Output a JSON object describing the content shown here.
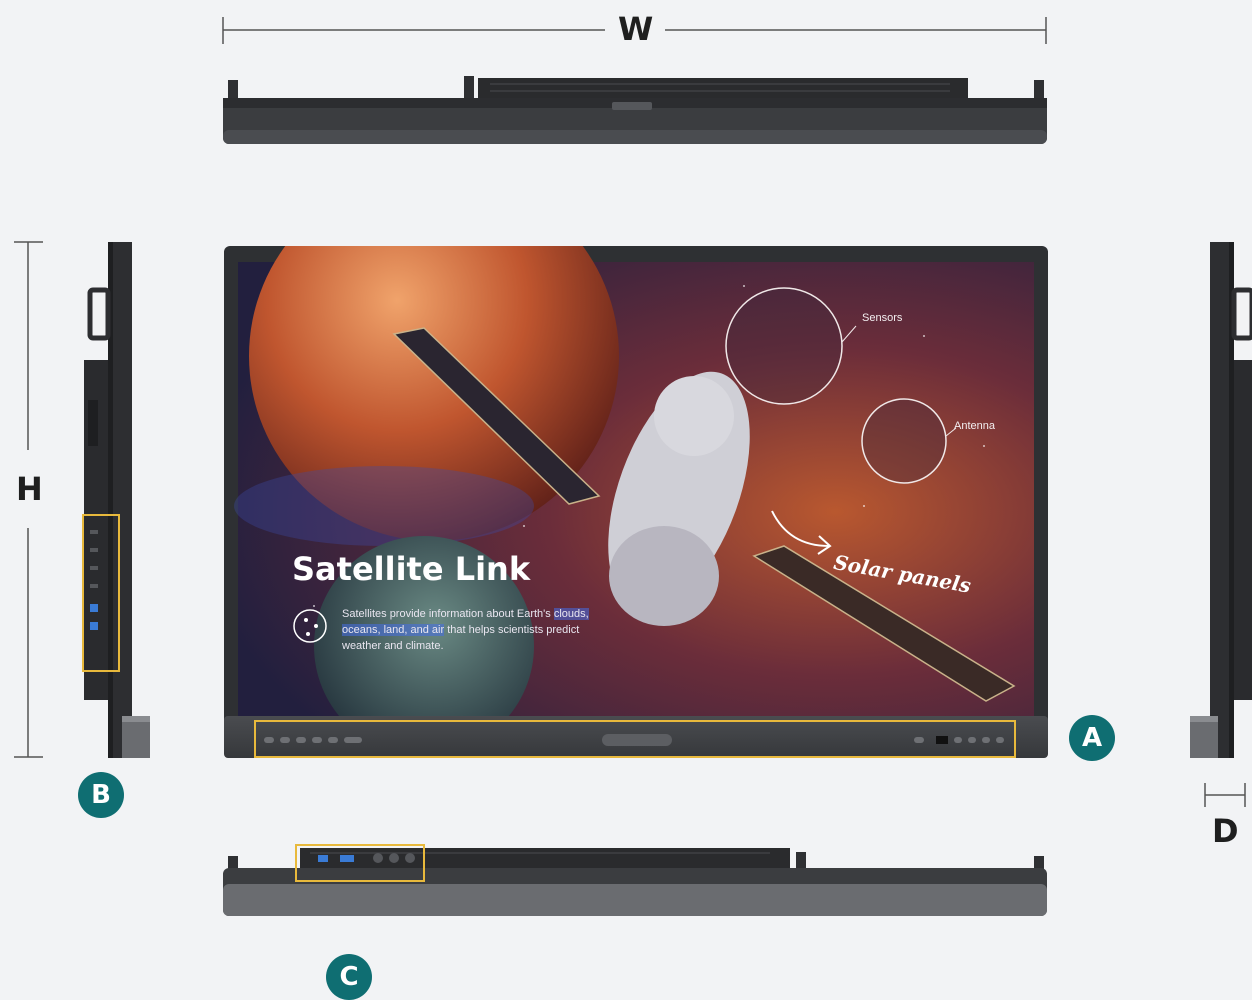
{
  "dimensions": {
    "width_label": "W",
    "height_label": "H",
    "depth_label": "D"
  },
  "badges": {
    "a": "A",
    "b": "B",
    "c": "C"
  },
  "screen": {
    "title": "Satellite Link",
    "body_before": "Satellites provide information about Earth's ",
    "body_highlight": "clouds, oceans, land, and air",
    "body_after": " that helps scientists predict weather and climate.",
    "callout_sensors": "Sensors",
    "callout_antenna": "Antenna",
    "callout_solar": "Solar panels"
  },
  "colors": {
    "background": "#f2f3f5",
    "badge": "#0f6e72",
    "highlight_frame": "#e8b93c",
    "device_body": "#3b3d40"
  }
}
